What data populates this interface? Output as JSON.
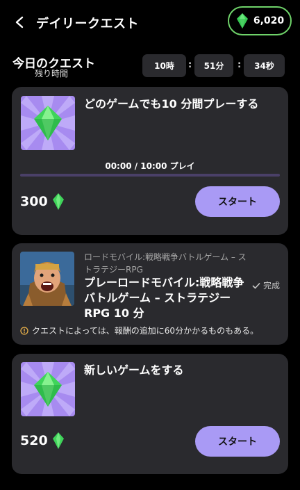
{
  "header": {
    "title": "デイリークエスト",
    "balance": "6,020"
  },
  "today": {
    "title": "今日のクエスト",
    "subtitle": "残り時間",
    "timer": [
      "10時",
      "51分",
      "34秒"
    ],
    "separator": ":"
  },
  "quests": [
    {
      "title": "どのゲームでも10 分間プレーする",
      "progress_text": "00:00 / 10:00 プレイ",
      "progress": 0.0,
      "reward": "300",
      "button": "スタート"
    },
    {
      "game_name": "ロードモバイル:戦略戦争バトルゲーム – ストラテジーRPG",
      "title": "プレーロードモバイル:戦略戦争バトルゲーム – ストラテジーRPG 10 分",
      "status": "完成",
      "note": "クエストによっては、報酬の追加に60分かかるものもある。"
    },
    {
      "title": "新しいゲームをする",
      "reward": "520",
      "button": "スタート"
    }
  ],
  "colors": {
    "background": "#000000",
    "card": "#2a2a2e",
    "accent": "#a99af5",
    "gem": "#3fd45a",
    "balance_border": "#6fd36a",
    "warning": "#e8b04a"
  }
}
